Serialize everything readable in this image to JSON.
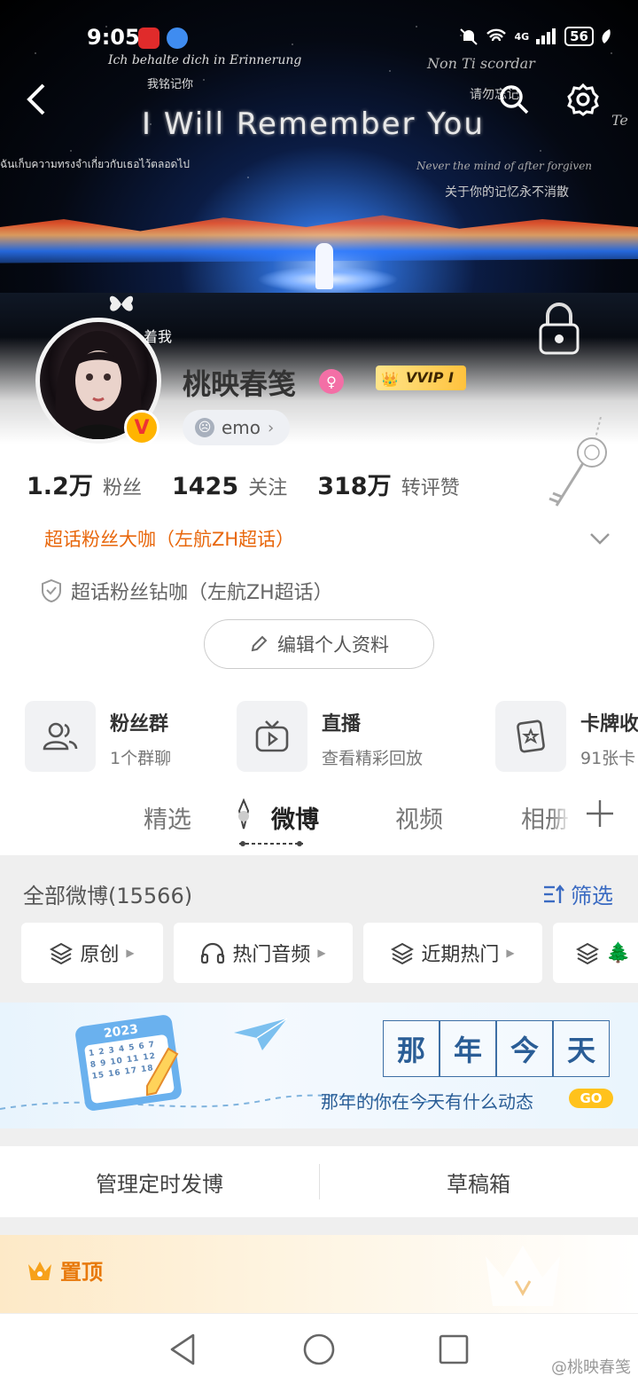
{
  "status_bar": {
    "time": "9:05",
    "network": "4G",
    "battery": "56"
  },
  "banner": {
    "line_de": "Ich behalte dich in Erinnerung",
    "line_cn1": "我铭记你",
    "title": "I Will Remember You",
    "line_thai": "ฉันเก็บความทรงจำเกี่ยวกับเธอไว้ตลอดไป",
    "line_it": "Non Ti scordar",
    "line_cn3": "请勿忘记",
    "line_en": "Never the mind of after forgiven",
    "line_cn2": "关于你的记忆永不消散",
    "line_te": "Te"
  },
  "profile": {
    "following_note": "着我",
    "username": "桃映春笺",
    "vip_label": "VVIP I",
    "mood": "emo",
    "stats": [
      {
        "num": "1.2万",
        "label": "粉丝"
      },
      {
        "num": "1425",
        "label": "关注"
      },
      {
        "num": "318万",
        "label": "转评赞"
      }
    ],
    "badge_primary": "超话粉丝大咖（左航ZH超话）",
    "badge_secondary": "超话粉丝钻咖（左航ZH超话）",
    "edit_label": "编辑个人资料"
  },
  "features": [
    {
      "title": "粉丝群",
      "sub": "1个群聊"
    },
    {
      "title": "直播",
      "sub": "查看精彩回放"
    },
    {
      "title": "卡牌收",
      "sub": "91张卡"
    }
  ],
  "tabs": [
    "精选",
    "微博",
    "视频",
    "相册"
  ],
  "posts": {
    "all_label": "全部微博(15566)",
    "filter_label": "筛选",
    "chips": [
      "原创",
      "热门音频",
      "近期热门",
      "🌲"
    ]
  },
  "memory": {
    "year": "2023",
    "chars": [
      "那",
      "年",
      "今",
      "天"
    ],
    "subtitle": "那年的你在今天有什么动态",
    "go": "GO"
  },
  "manage": {
    "scheduled": "管理定时发博",
    "drafts": "草稿箱"
  },
  "pinned": {
    "label": "置顶"
  },
  "watermark": "@桃映春笺"
}
